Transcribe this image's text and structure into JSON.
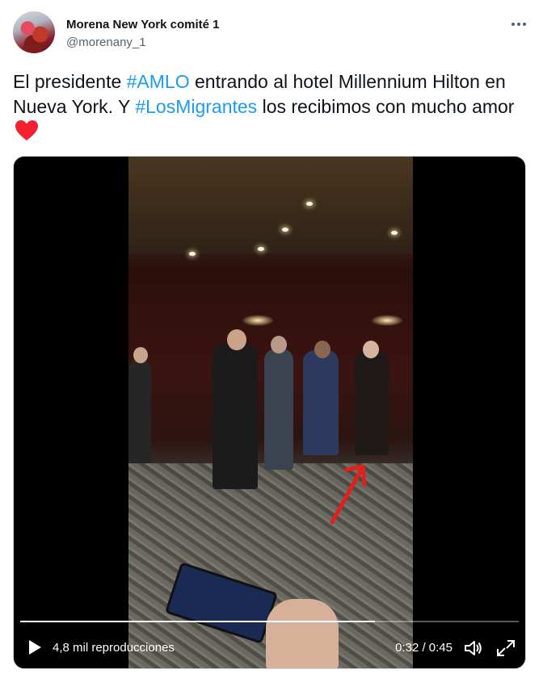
{
  "tweet": {
    "author_name": "Morena New York comité 1",
    "author_handle": "@morenany_1",
    "text_parts": {
      "p1": "El presidente ",
      "tag1": "#AMLO",
      "p2": " entrando al hotel Millennium Hilton en Nueva York. Y ",
      "tag2": "#LosMigrantes",
      "p3": " los recibimos con mucho amor"
    },
    "emoji": "red-heart"
  },
  "video": {
    "views": "4,8 mil reproducciones",
    "time": "0:32 / 0:45",
    "progress": 0.711
  },
  "colors": {
    "link": "#1d9bf0",
    "heart": "#f4212e",
    "arrow": "#e0211b"
  },
  "icons": [
    "more-icon",
    "play-icon",
    "volume-icon",
    "fullscreen-icon",
    "red-arrow"
  ]
}
